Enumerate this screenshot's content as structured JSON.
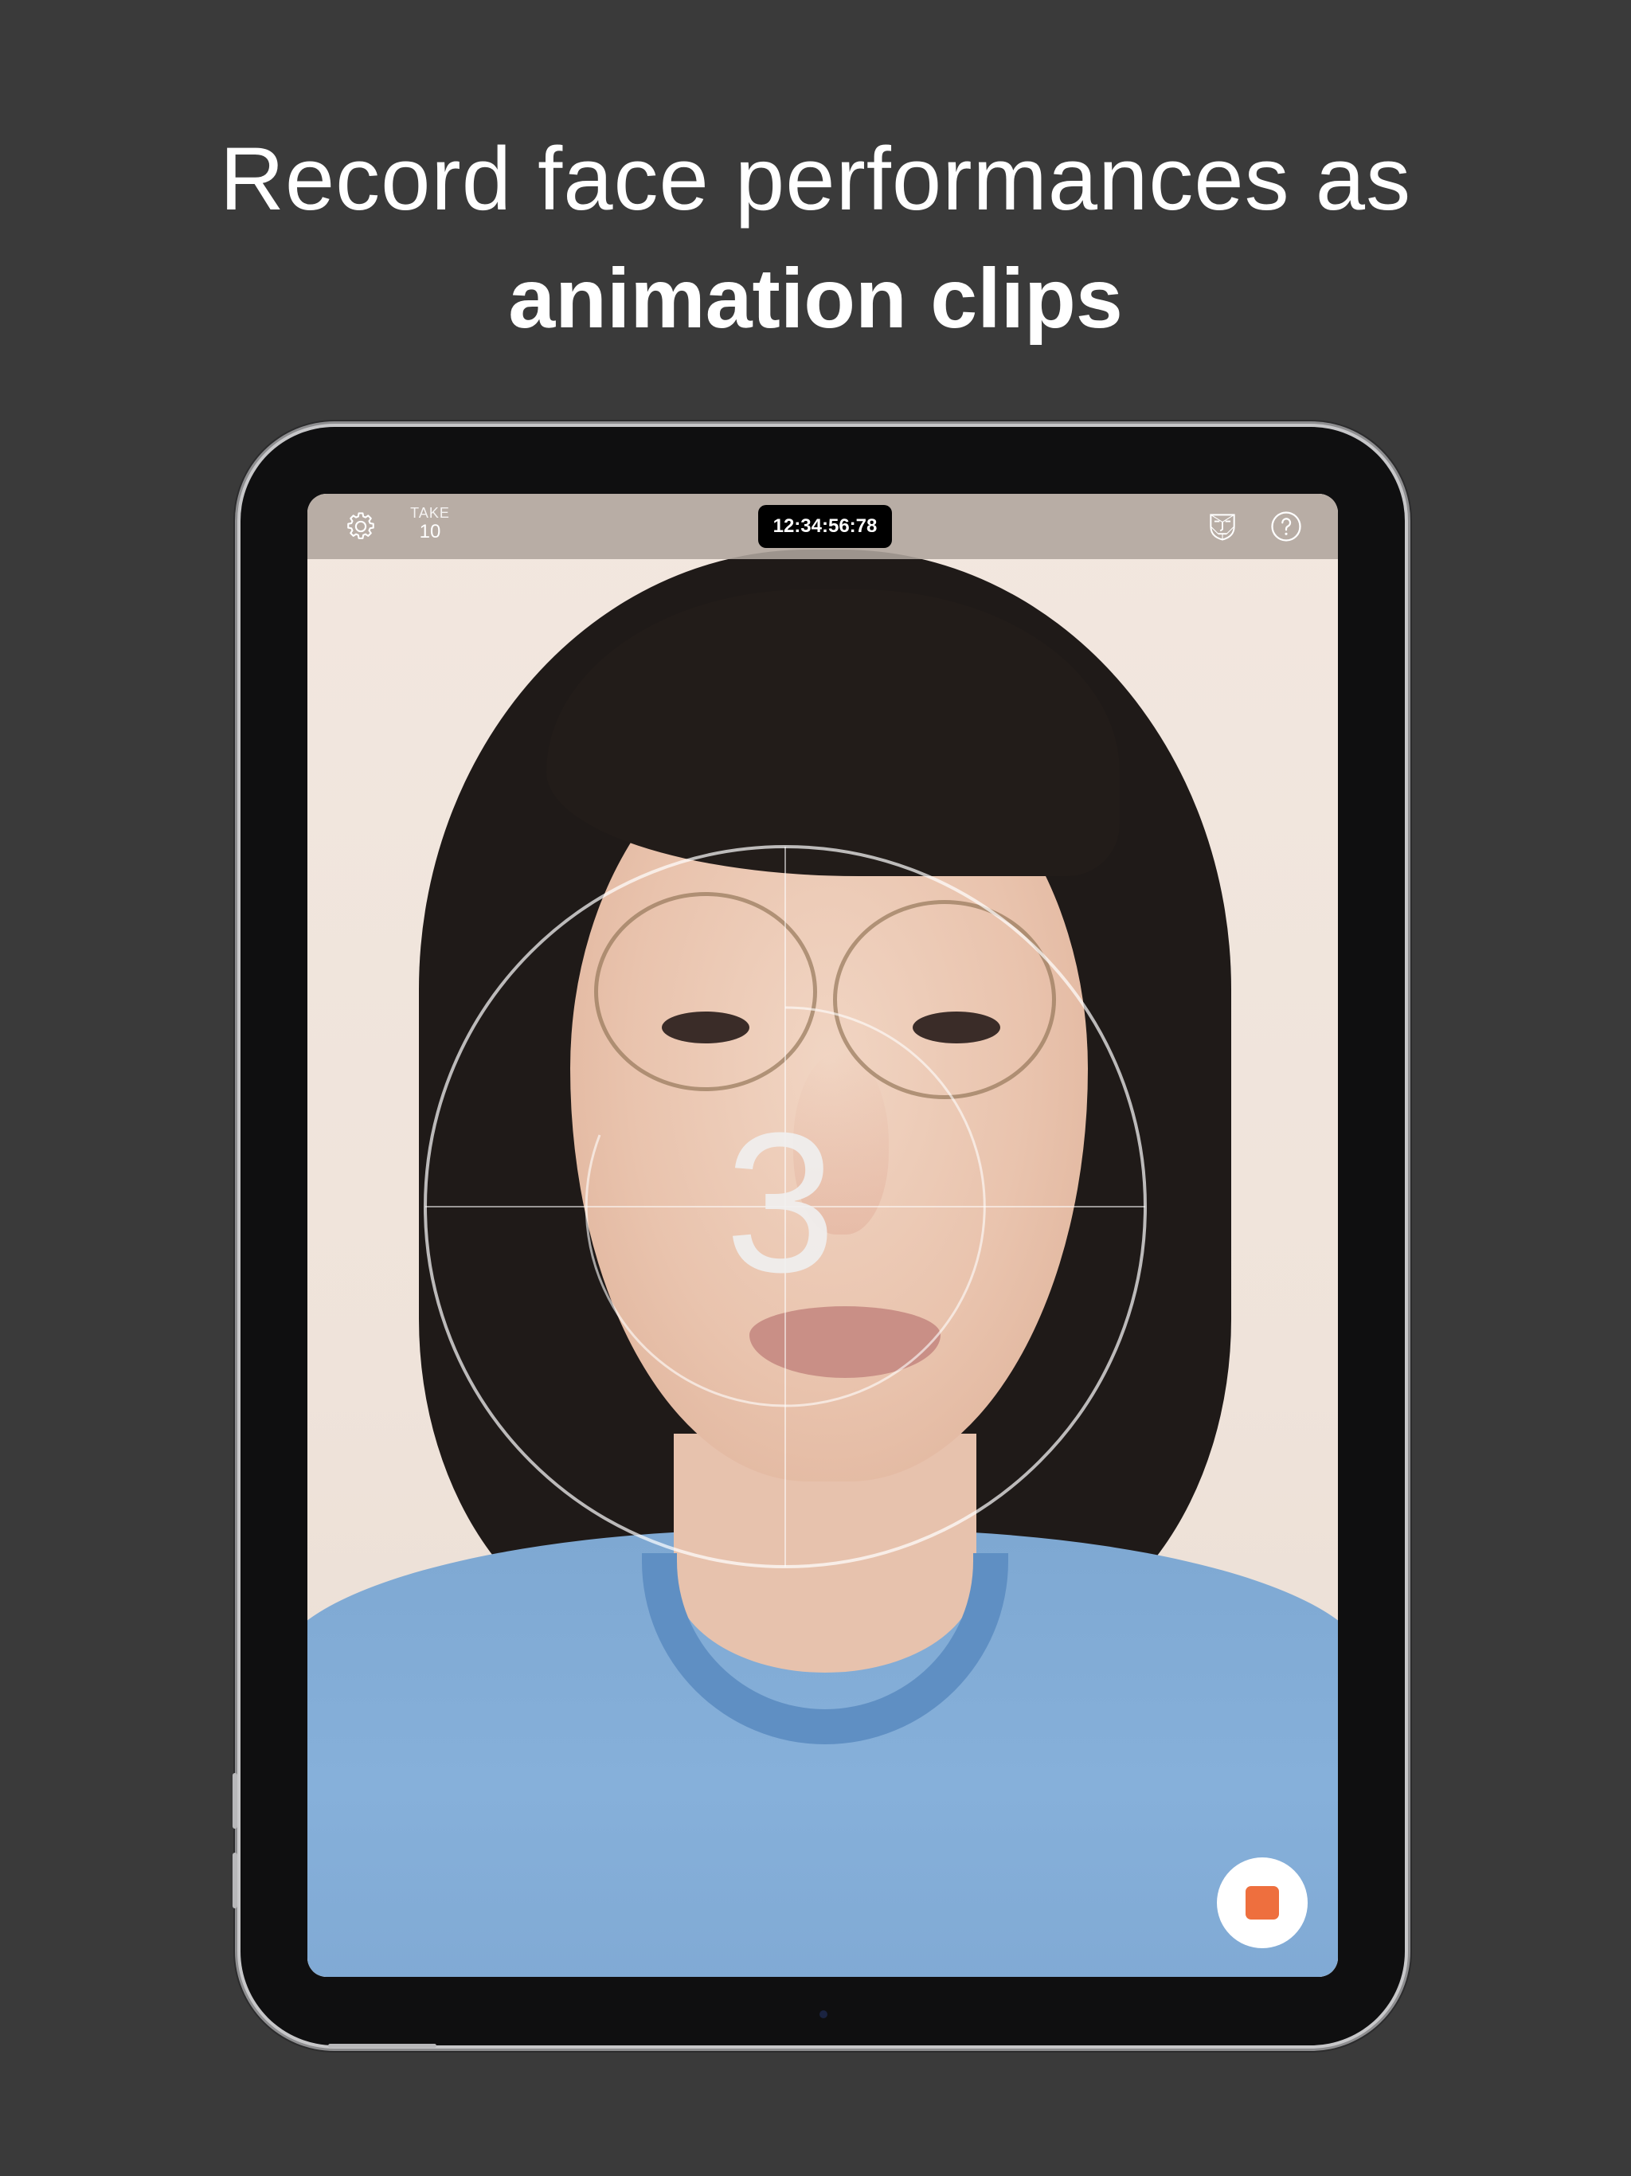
{
  "headline": {
    "line1": "Record face performances as",
    "line2": "animation clips"
  },
  "topbar": {
    "take_label": "TAKE",
    "take_number": "10",
    "timecode": "12:34:56:78",
    "icons": {
      "settings": "gear-icon",
      "face_mesh": "face-mask-icon",
      "help": "help-icon"
    }
  },
  "countdown": {
    "number": "3"
  },
  "record": {
    "icon": "stop-icon",
    "color": "#ee6f3e"
  },
  "colors": {
    "background": "#3a3a3a",
    "accent": "#ee6f3e",
    "timecode_bg": "#000000"
  }
}
